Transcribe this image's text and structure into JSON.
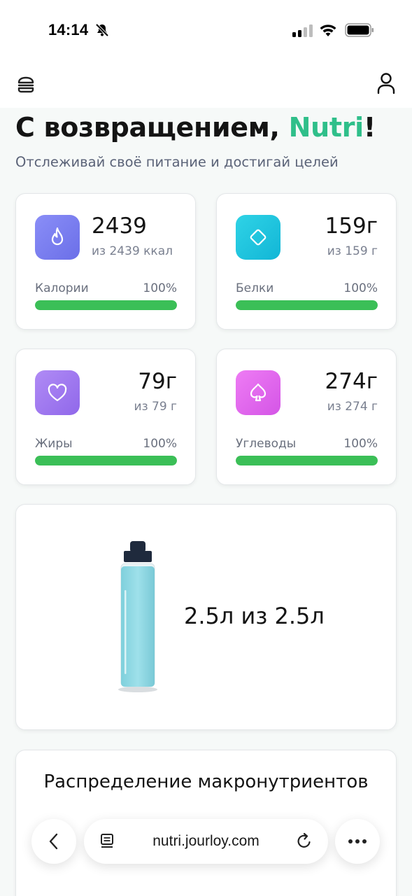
{
  "status_bar": {
    "time": "14:14"
  },
  "greeting": {
    "prefix": "С возвращением, ",
    "name": "Nutri",
    "suffix": "!"
  },
  "subtitle": "Отслеживай своё питание и достигай целей",
  "stats": [
    {
      "label": "Калории",
      "value": "2439",
      "of": "из 2439 ккал",
      "percent": "100%",
      "progress": 1.0,
      "icon": "flame-icon",
      "color": "#7b7ff2"
    },
    {
      "label": "Белки",
      "value": "159г",
      "of": "из 159 г",
      "percent": "100%",
      "progress": 1.0,
      "icon": "diamond-icon",
      "color": "#1fc7de"
    },
    {
      "label": "Жиры",
      "value": "79г",
      "of": "из 79 г",
      "percent": "100%",
      "progress": 1.0,
      "icon": "heart-icon",
      "color": "#a77ff2"
    },
    {
      "label": "Углеводы",
      "value": "274г",
      "of": "из 274 г",
      "percent": "100%",
      "progress": 1.0,
      "icon": "spade-icon",
      "color": "#e468ee"
    }
  ],
  "water": {
    "amount": "2.5л из 2.5л",
    "fill_level": 1.0,
    "icon": "water-bottle-icon"
  },
  "macros": {
    "title": "Распределение макронутриентов"
  },
  "browser": {
    "url": "nutri.jourloy.com"
  },
  "colors": {
    "accent": "#2fbf8a",
    "progress": "#3bbf57"
  }
}
